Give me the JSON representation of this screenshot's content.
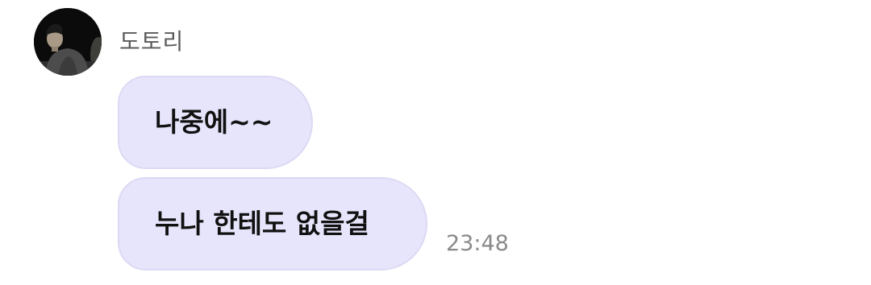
{
  "chat": {
    "sender": {
      "name": "도토리",
      "avatar": "profile-photo"
    },
    "messages": [
      {
        "text": "나중에~~"
      },
      {
        "text": "누나 한테도 없을걸"
      }
    ],
    "timestamp": "23:48"
  },
  "colors": {
    "bubble": "#e7e5fb",
    "bubble_border": "#dcd9f4",
    "name_text": "#5a5a5a",
    "message_text": "#111111",
    "timestamp_text": "#8a8a8a"
  }
}
